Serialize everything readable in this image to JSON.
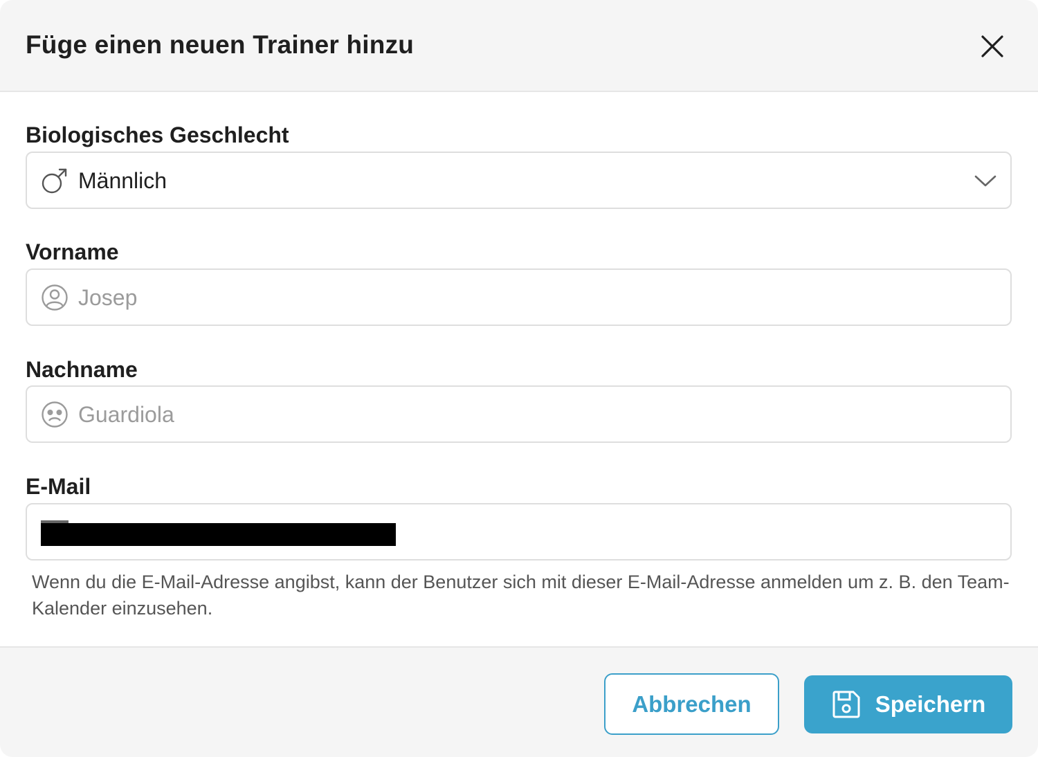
{
  "dialog": {
    "title": "Füge einen neuen Trainer hinzu"
  },
  "form": {
    "gender": {
      "label": "Biologisches Geschlecht",
      "value": "Männlich",
      "icon": "male-symbol-icon"
    },
    "first_name": {
      "label": "Vorname",
      "placeholder": "Josep",
      "icon": "user-circle-icon"
    },
    "last_name": {
      "label": "Nachname",
      "placeholder": "Guardiola",
      "icon": "face-icon"
    },
    "email": {
      "label": "E-Mail",
      "helper": "Wenn du die E-Mail-Adresse angibst, kann der Benutzer sich mit dieser E-Mail-Adresse anmelden um z. B. den Team-Kalender einzusehen."
    }
  },
  "footer": {
    "cancel_label": "Abbrechen",
    "save_label": "Speichern",
    "save_icon": "floppy-disk-icon"
  },
  "colors": {
    "accent": "#3aa3cc",
    "header_bg": "#f5f5f5",
    "placeholder": "#9b9b9b"
  }
}
